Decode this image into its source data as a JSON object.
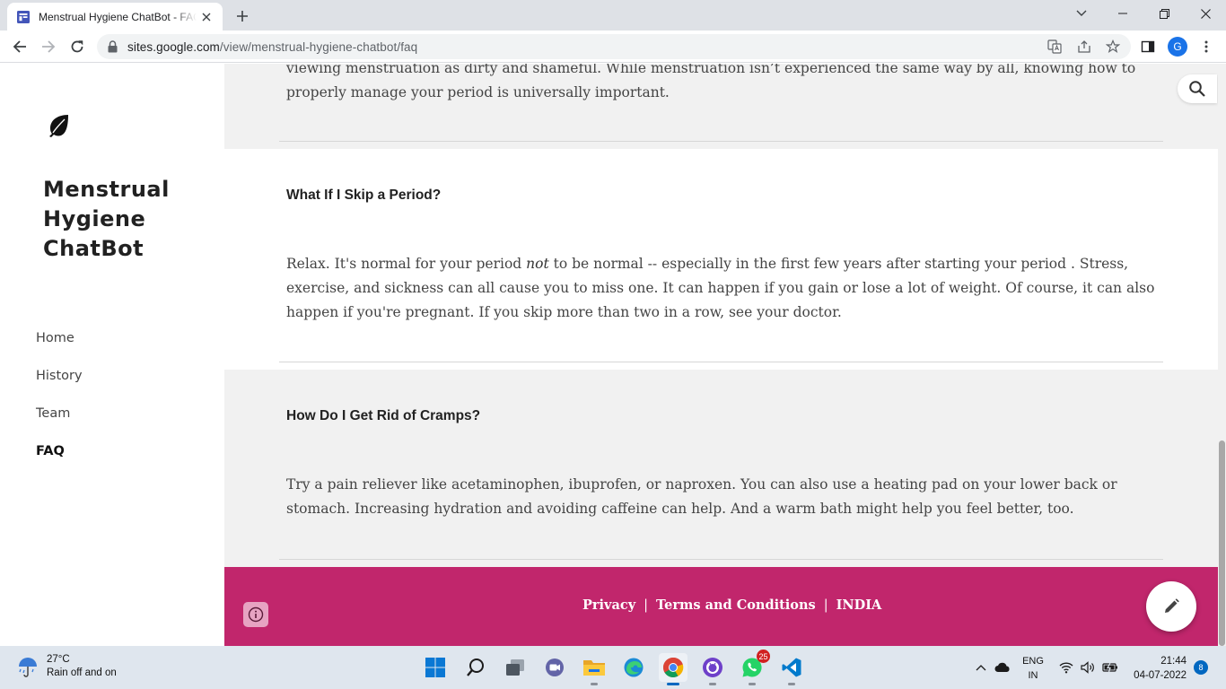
{
  "browser": {
    "tab_title": "Menstrual Hygiene ChatBot - FAQ",
    "url_host": "sites.google.com",
    "url_path": "/view/menstrual-hygiene-chatbot/faq",
    "profile_initial": "G"
  },
  "site": {
    "title": "Menstrual Hygiene ChatBot",
    "nav": [
      {
        "label": "Home"
      },
      {
        "label": "History"
      },
      {
        "label": "Team"
      },
      {
        "label": "FAQ",
        "active": true
      }
    ]
  },
  "content": {
    "top_partial": "viewing menstruation as dirty and shameful. While menstruation isn’t experienced the same way by all, knowing how to properly manage your period is universally important.",
    "faqs": [
      {
        "question": "What If I Skip a Period?",
        "answer_before": "Relax. It's normal for your period ",
        "answer_em": "not",
        "answer_after": " to be normal -- especially in the first few years after starting your period . Stress, exercise, and sickness can all cause you to miss one. It can happen if you gain or lose a lot of weight. Of course, it can also happen if you're pregnant. If you skip more than two in a row, see your doctor."
      },
      {
        "question": "How Do I Get Rid of Cramps?",
        "answer": "Try a pain reliever like acetaminophen, ibuprofen, or naproxen. You can also use a heating pad on your lower back or stomach. Increasing hydration and avoiding caffeine can help. And a warm bath might help you feel better, too."
      }
    ]
  },
  "footer": {
    "links": [
      "Privacy",
      "Terms and Conditions",
      "INDIA"
    ],
    "separator": "|"
  },
  "taskbar": {
    "weather_temp": "27°C",
    "weather_desc": "Rain off and on",
    "whatsapp_badge": "25",
    "lang_line1": "ENG",
    "lang_line2": "IN",
    "time": "21:44",
    "date": "04-07-2022",
    "notification_count": "8"
  },
  "colors": {
    "footer_bg": "#c1266c",
    "section_gray": "#f1f1f1",
    "accent_blue": "#1a73e8"
  }
}
